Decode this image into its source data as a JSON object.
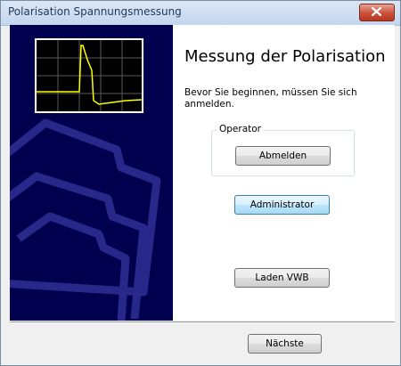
{
  "window": {
    "title": "Polarisation Spannungsmessung"
  },
  "colors": {
    "sidepanel": "#00004e",
    "scope_trace": "#ffff00",
    "scope_grid": "#5a5a5a"
  },
  "main": {
    "heading": "Messung der Polarisation",
    "intro": "Bevor Sie beginnen, müssen Sie sich anmelden.",
    "operator_group": {
      "label": "Operator",
      "logout_label": "Abmelden"
    },
    "admin_label": "Administrator",
    "load_label": "Laden VWB"
  },
  "footer": {
    "next_label": "Nächste"
  }
}
